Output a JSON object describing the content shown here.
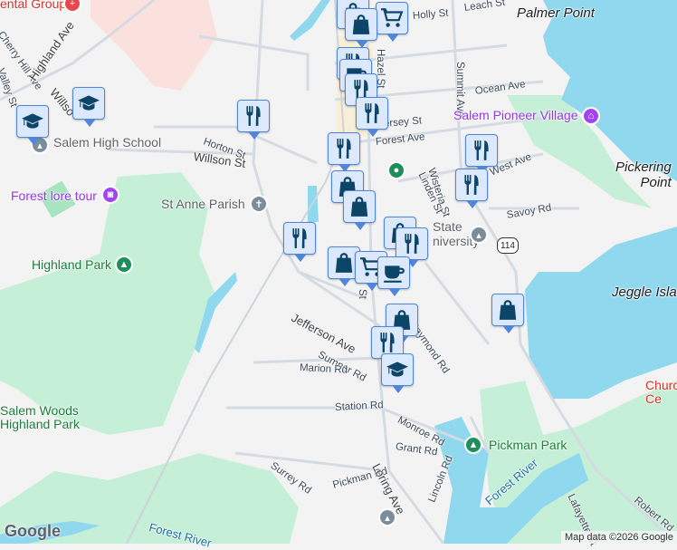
{
  "map": {
    "labels": {
      "dental_group": "ental Group",
      "cherry_hill": "Cherry Hill Ave",
      "valley": "Valley St",
      "highland_ave": "Highland Ave",
      "willson_nw": "Willso",
      "salem_high": "Salem High School",
      "horton": "Horton St",
      "willson": "Willson St",
      "forest_lore": "Forest lore tour",
      "st_anne": "St Anne Parish",
      "highland_park": "Highland Park",
      "holly": "Holly St",
      "leach": "Leach St",
      "palmer_point": "Palmer Point",
      "hazel": "Hazel St",
      "summit": "Summit Ave",
      "ocean": "Ocean Ave",
      "pioneer": "Salem Pioneer Village",
      "jersey": "ersey St",
      "forest_ave": "Forest Ave",
      "wisteria": "Wisteria St",
      "linden": "Linden St",
      "west": "West Ave",
      "pickering": "Pickering\nPoint",
      "savoy": "Savoy Rd",
      "state_univ": "State\nniversity",
      "jeggle": "Jeggle Island",
      "raymond": "Raymond Rd",
      "jefferson": "Jefferson Ave",
      "sumner": "Sumner Rd",
      "marion": "Marion Rd",
      "station": "Station Rd",
      "monroe": "Monroe Rd",
      "salem_woods": "Salem Woods\nHighland Park",
      "pickman_park": "Pickman Park",
      "grant": "Grant Rd",
      "surrey": "Surrey Rd",
      "pickman_rd": "Pickman Rd",
      "loring": "Loring Ave",
      "lincoln": "Lincoln Rd",
      "forest_river": "Forest River",
      "forest_river_sw": "Forest River",
      "lafayette": "Lafayette St",
      "robert": "Robert Rd",
      "church": "Churc\nCe",
      "st_frag": "St"
    },
    "route_shield": "114",
    "attribution": "Map data ©2026 Google",
    "logo": "Google"
  },
  "colors": {
    "water": "#8fd8ee",
    "park": "#c6efd7",
    "marker_bg": "#dce8fb",
    "marker_border": "#4f86d9",
    "marker_icon": "#0c4568"
  }
}
